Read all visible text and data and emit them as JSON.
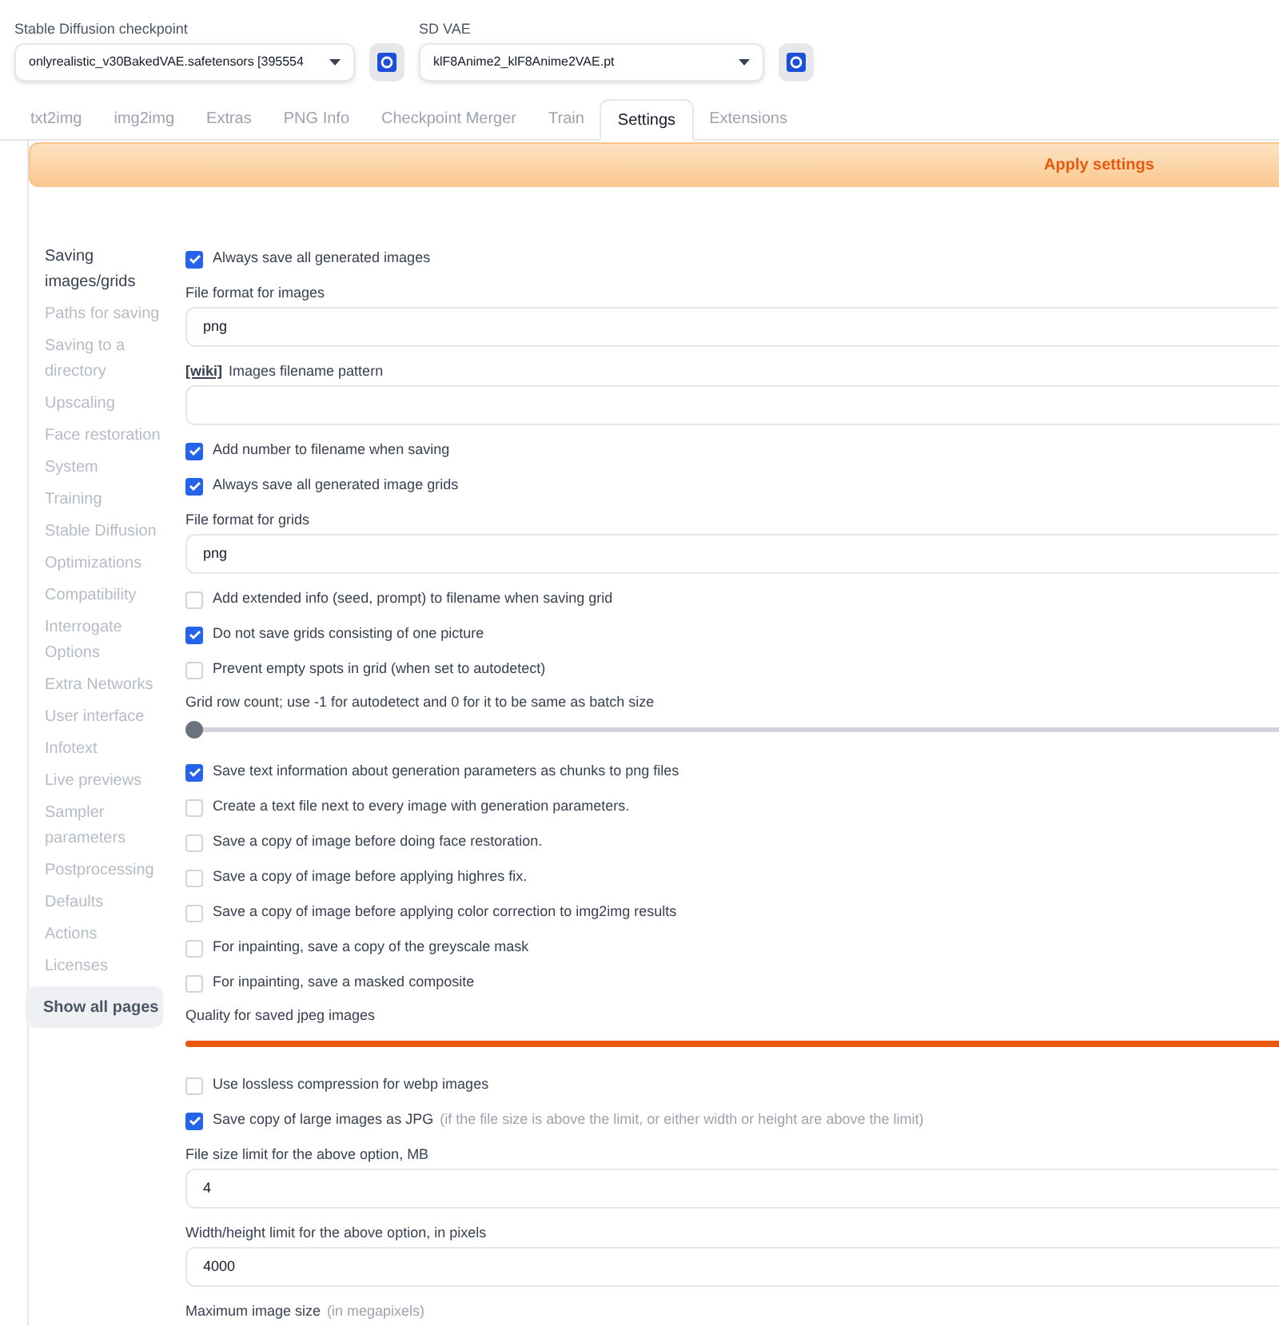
{
  "model_selectors": [
    {
      "label": "Stable Diffusion checkpoint",
      "value": "onlyrealistic_v30BakedVAE.safetensors [395554"
    },
    {
      "label": "SD VAE",
      "value": "klF8Anime2_klF8Anime2VAE.pt"
    }
  ],
  "tabs": [
    {
      "label": "txt2img",
      "selected": false
    },
    {
      "label": "img2img",
      "selected": false
    },
    {
      "label": "Extras",
      "selected": false
    },
    {
      "label": "PNG Info",
      "selected": false
    },
    {
      "label": "Checkpoint Merger",
      "selected": false
    },
    {
      "label": "Train",
      "selected": false
    },
    {
      "label": "Settings",
      "selected": true
    },
    {
      "label": "Extensions",
      "selected": false
    }
  ],
  "apply_button": "Apply settings",
  "sidebar": {
    "items": [
      {
        "label": "Saving images/grids",
        "selected": true
      },
      {
        "label": "Paths for saving",
        "selected": false
      },
      {
        "label": "Saving to a directory",
        "selected": false
      },
      {
        "label": "Upscaling",
        "selected": false
      },
      {
        "label": "Face restoration",
        "selected": false
      },
      {
        "label": "System",
        "selected": false
      },
      {
        "label": "Training",
        "selected": false
      },
      {
        "label": "Stable Diffusion",
        "selected": false
      },
      {
        "label": "Optimizations",
        "selected": false
      },
      {
        "label": "Compatibility",
        "selected": false
      },
      {
        "label": "Interrogate Options",
        "selected": false
      },
      {
        "label": "Extra Networks",
        "selected": false
      },
      {
        "label": "User interface",
        "selected": false
      },
      {
        "label": "Infotext",
        "selected": false
      },
      {
        "label": "Live previews",
        "selected": false
      },
      {
        "label": "Sampler parameters",
        "selected": false
      },
      {
        "label": "Postprocessing",
        "selected": false
      },
      {
        "label": "Defaults",
        "selected": false
      },
      {
        "label": "Actions",
        "selected": false
      },
      {
        "label": "Licenses",
        "selected": false
      }
    ],
    "show_all_button": "Show all pages"
  },
  "settings": [
    {
      "kind": "checkbox",
      "label": "Always save all generated images",
      "checked": true
    },
    {
      "kind": "text",
      "label": "File format for images",
      "value": "png"
    },
    {
      "kind": "text",
      "link": "[wiki]",
      "label": "Images filename pattern"
    },
    {
      "kind": "checkbox",
      "label": "Add number to filename when saving",
      "checked": true
    },
    {
      "kind": "checkbox",
      "label": "Always save all generated image grids",
      "checked": true
    },
    {
      "kind": "text",
      "label": "File format for grids",
      "value": "png"
    },
    {
      "kind": "checkbox",
      "label": "Add extended info (seed, prompt) to filename when saving grid",
      "checked": false
    },
    {
      "kind": "checkbox",
      "label": "Do not save grids consisting of one picture",
      "checked": true
    },
    {
      "kind": "checkbox",
      "label": "Prevent empty spots in grid (when set to autodetect)",
      "checked": false
    },
    {
      "kind": "slider",
      "label": "Grid row count; use -1 for autodetect and 0 for it to be same as batch size",
      "level": 0
    },
    {
      "kind": "checkbox",
      "label": "Save text information about generation parameters as chunks to png files",
      "checked": true
    },
    {
      "kind": "checkbox",
      "label": "Create a text file next to every image with generation parameters.",
      "checked": false
    },
    {
      "kind": "checkbox",
      "label": "Save a copy of image before doing face restoration.",
      "checked": false
    },
    {
      "kind": "checkbox",
      "label": "Save a copy of image before applying highres fix.",
      "checked": false
    },
    {
      "kind": "checkbox",
      "label": "Save a copy of image before applying color correction to img2img results",
      "checked": false
    },
    {
      "kind": "checkbox",
      "label": "For inpainting, save a copy of the greyscale mask",
      "checked": false
    },
    {
      "kind": "checkbox",
      "label": "For inpainting, save a masked composite",
      "checked": false
    },
    {
      "kind": "slider",
      "label": "Quality for saved jpeg images",
      "level": 1
    },
    {
      "kind": "checkbox",
      "label": "Use lossless compression for webp images",
      "checked": false
    },
    {
      "kind": "checkbox",
      "label": "Save copy of large images as JPG",
      "note": "(if the file size is above the limit, or either width or height are above the limit)",
      "checked": true
    },
    {
      "kind": "text",
      "label": "File size limit for the above option, MB",
      "value": "4"
    },
    {
      "kind": "text",
      "label": "Width/height limit for the above option, in pixels",
      "value": "4000"
    },
    {
      "kind": "text",
      "label": "Maximum image size",
      "note": "(in megapixels)"
    }
  ]
}
